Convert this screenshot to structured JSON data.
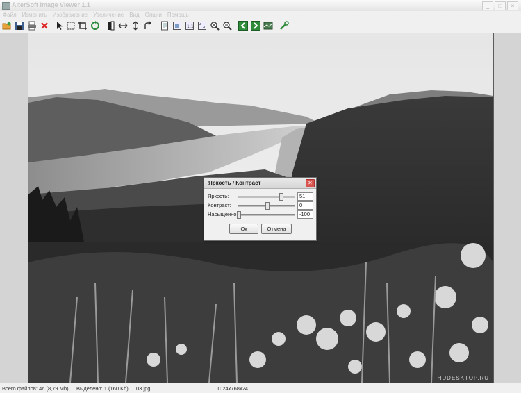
{
  "window": {
    "title": "AlterSoft Image Viewer 1.1",
    "controls": [
      "_",
      "□",
      "×"
    ]
  },
  "menu": [
    "Файл",
    "Изменить",
    "Изображение",
    "Увеличение",
    "Вид",
    "Опции",
    "Помощь"
  ],
  "toolbar": {
    "icons": [
      "open-icon",
      "save-icon",
      "print-icon",
      "delete-icon",
      "pointer-icon",
      "select-icon",
      "crop-icon",
      "rotate-icon",
      "mirror-icon",
      "flip-horizontal-icon",
      "flip-vertical-icon",
      "rotate-right-icon",
      "page-icon",
      "zoom-fit-icon",
      "actual-size-icon",
      "full-screen-icon",
      "zoom-in-icon",
      "zoom-out-icon",
      "previous-icon",
      "next-icon",
      "slideshow-icon",
      "settings-icon"
    ]
  },
  "image": {
    "watermark": "HDDESKTOP.RU"
  },
  "dialog": {
    "title": "Яркость / Контраст",
    "rows": [
      {
        "label": "Яркость:",
        "value": "51",
        "level": 0.75
      },
      {
        "label": "Контраст:",
        "value": "0",
        "level": 0.5
      },
      {
        "label": "Насыщенно",
        "value": "-100",
        "level": 0.0
      }
    ],
    "ok_label": "Ок",
    "cancel_label": "Отмена"
  },
  "status": {
    "total_files": "Всего файлов: 46 (8,79 Mb)",
    "selected": "Выделено: 1 (160 Kb)",
    "filename": "03.jpg",
    "dimensions": "1024x768x24"
  },
  "colors": {
    "frame": "#d4d4d4",
    "dialog_close": "#d9534f",
    "nav_green": "#2e8b3a"
  }
}
